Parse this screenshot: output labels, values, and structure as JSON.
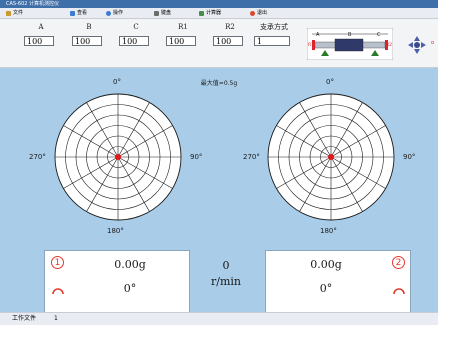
{
  "window": {
    "title": "CAS-602 计算机测控仪"
  },
  "menu": [
    {
      "label": "文件",
      "icon": "file-icon",
      "color": "#c99a2e"
    },
    {
      "label": "查看",
      "icon": "view-icon",
      "color": "#3d7bd1"
    },
    {
      "label": "操作",
      "icon": "operate-icon",
      "color": "#3d7bd1"
    },
    {
      "label": "键盘",
      "icon": "keyboard-icon",
      "color": "#6b6b6b"
    },
    {
      "label": "计算器",
      "icon": "calculator-icon",
      "color": "#4a8c4a"
    },
    {
      "label": "退出",
      "icon": "exit-icon",
      "color": "#d84a2a"
    }
  ],
  "fields": [
    {
      "label": "A",
      "value": "100"
    },
    {
      "label": "B",
      "value": "100"
    },
    {
      "label": "C",
      "value": "100"
    },
    {
      "label": "R1",
      "value": "100"
    },
    {
      "label": "R2",
      "value": "100"
    },
    {
      "label": "支承方式",
      "value": "1"
    }
  ],
  "diagram": {
    "a": "A",
    "b": "B",
    "c": "C",
    "r1": "R1",
    "r2": "R2"
  },
  "max_label": "最大值=0.5g",
  "polar_labels": {
    "top": "0°",
    "right": "90°",
    "bottom": "180°",
    "left": "270°"
  },
  "panel_left": {
    "badge": "1",
    "amount": "0.00g",
    "angle": "0°"
  },
  "panel_right": {
    "badge": "2",
    "amount": "0.00g",
    "angle": "0°"
  },
  "speed": {
    "value": "0",
    "unit": "r/min"
  },
  "status": {
    "label": "工作文件",
    "value": "1"
  },
  "colors": {
    "background": "#a9cde9",
    "accent_red": "#e23b2e",
    "plot_center": "#e01818"
  }
}
